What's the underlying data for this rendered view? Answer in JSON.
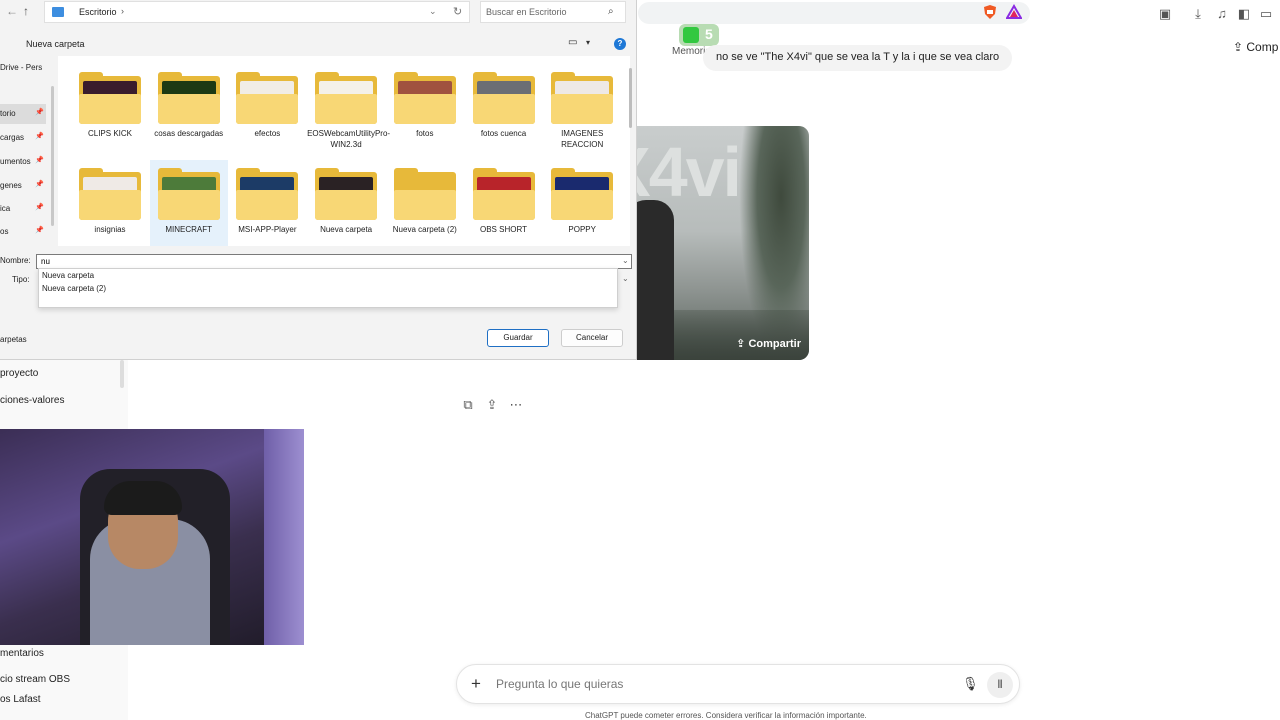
{
  "browser": {
    "memory_note": "Memoria guardada llena",
    "ext_badge_count": "5",
    "share_label": "Comp",
    "toolbar_icons": [
      "screenshot-icon",
      "download-icon",
      "music-icon",
      "sidebar-icon",
      "wallet-icon"
    ]
  },
  "chat": {
    "user_message": "no se ve \"The X4vi\" que se vea la T y la i que se vea claro",
    "image_title": "X4vi",
    "image_share": "Compartir",
    "composer_placeholder": "Pregunta lo que quieras",
    "disclaimer": "ChatGPT puede cometer errores. Considera verificar la información importante."
  },
  "sidebar": {
    "items": [
      "proyecto",
      "ciones-valores",
      "mentarios",
      "cio stream OBS",
      "os Lafast"
    ]
  },
  "dialog": {
    "path": "Escritorio",
    "search_placeholder": "Buscar en Escritorio",
    "new_folder": "Nueva carpeta",
    "nav_items": [
      {
        "label": "Drive - Pers",
        "pinned": false,
        "selected": false
      },
      {
        "label": "torio",
        "pinned": true,
        "selected": true
      },
      {
        "label": "cargas",
        "pinned": true,
        "selected": false
      },
      {
        "label": "umentos",
        "pinned": true,
        "selected": false
      },
      {
        "label": "genes",
        "pinned": true,
        "selected": false
      },
      {
        "label": "ica",
        "pinned": true,
        "selected": false
      },
      {
        "label": "os",
        "pinned": true,
        "selected": false
      }
    ],
    "folders": [
      {
        "name": "CLIPS KICK",
        "thumb": "#3a1c2c"
      },
      {
        "name": "cosas descargadas",
        "thumb": "#1d3a14"
      },
      {
        "name": "efectos",
        "thumb": "#f1ede6"
      },
      {
        "name": "EOSWebcamUtilityPro-WIN2.3d",
        "thumb": "#f4f1ea"
      },
      {
        "name": "fotos",
        "thumb": "#a0523f"
      },
      {
        "name": "fotos cuenca",
        "thumb": "#6b6e74"
      },
      {
        "name": "IMAGENES REACCION",
        "thumb": "#eee9e6"
      },
      {
        "name": "insignias",
        "thumb": "#efeae6"
      },
      {
        "name": "MINECRAFT",
        "thumb": "#4d7b3a"
      },
      {
        "name": "MSI-APP-Player",
        "thumb": "#1c3b66"
      },
      {
        "name": "Nueva carpeta",
        "thumb": "#2a2224"
      },
      {
        "name": "Nueva carpeta (2)",
        "thumb": ""
      },
      {
        "name": "OBS SHORT",
        "thumb": "#b8242a"
      },
      {
        "name": "POPPY",
        "thumb": "#1a2a6e"
      }
    ],
    "name_label": "Nombre:",
    "name_value": "nu",
    "type_label": "Tipo:",
    "autocomplete": [
      "Nueva carpeta",
      "Nueva carpeta (2)"
    ],
    "hide_folders": "arpetas",
    "save": "Guardar",
    "cancel": "Cancelar"
  }
}
